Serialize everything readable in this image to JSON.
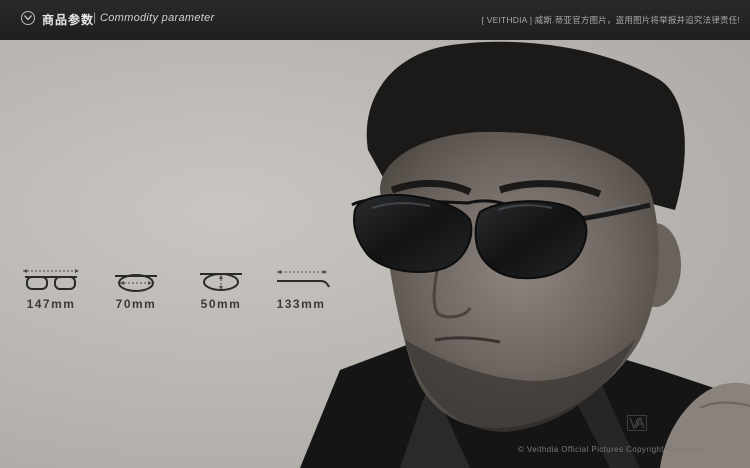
{
  "header": {
    "title": "商品参数",
    "separator": "|",
    "subtitle": "Commodity parameter",
    "notice": "[ VEITHDIA ] 威斯.蒂亚官方图片，盗用图片将举报并追究法律责任!"
  },
  "measurements": [
    {
      "icon": "frame-width-icon",
      "label": "147mm"
    },
    {
      "icon": "lens-width-icon",
      "label": "70mm"
    },
    {
      "icon": "lens-height-icon",
      "label": "50mm"
    },
    {
      "icon": "temple-length-icon",
      "label": "133mm"
    }
  ],
  "footer": {
    "copyright": "©  Veithdia Official Pictures Copyright Reserved",
    "brand_mark": "VA"
  },
  "colors": {
    "header_bg": "#222222",
    "background": "#b9b6b1",
    "label": "#3a3a3a"
  }
}
